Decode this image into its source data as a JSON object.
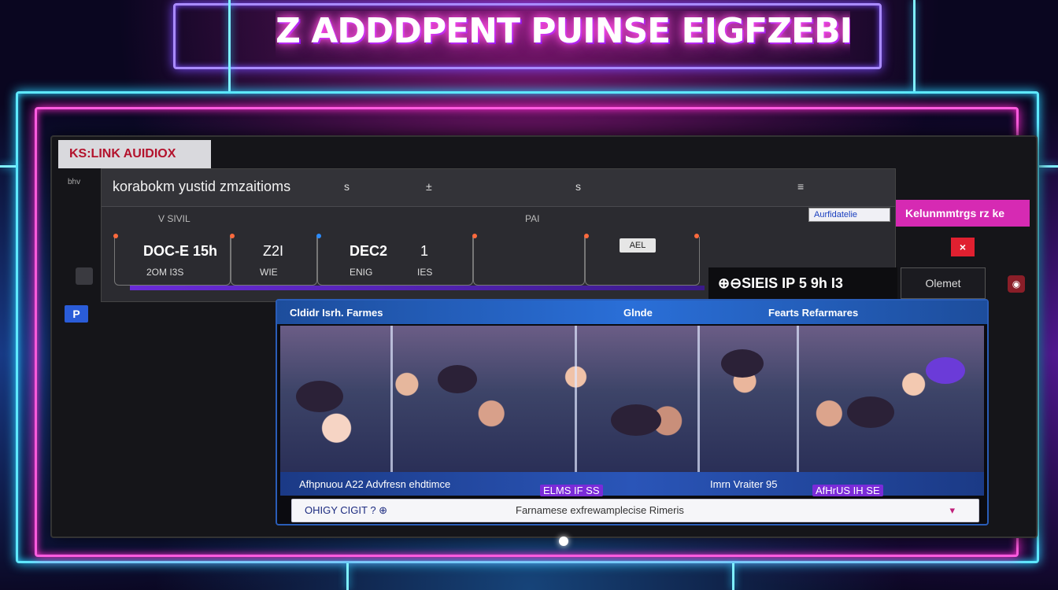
{
  "banner": {
    "title": "Z ADDDPENT PUINSE EIGFZEBIOM"
  },
  "app": {
    "tag": "KS:LINK AUIDIOX",
    "side_tab": "bhv",
    "side_badge": "P"
  },
  "panel": {
    "title": "korabokm yustid zmzaitioms",
    "header_icons": [
      "s",
      "±",
      "s",
      "≡"
    ],
    "sub_left": "V SIVIL",
    "sub_mid": "PAI",
    "stats": [
      {
        "value": "DOC-E 15h",
        "sub": "2OM I3S"
      },
      {
        "value": "Z2I",
        "sub": "WIE"
      },
      {
        "value": "DEC2",
        "sub": "ENIG"
      },
      {
        "value": "1",
        "sub": "IES"
      },
      {
        "value": "",
        "sub": ""
      }
    ],
    "mini_badge": "AEL"
  },
  "side": {
    "search_label": "Aurfidatelie",
    "pink_banner": "Kelunmmtrgs rz ke",
    "action_strip": "⊕⊖SIEIS IP 5 9h I3",
    "ghost_button": "Olemet"
  },
  "media": {
    "head_left": "Cldidr Isrh. Farmes",
    "head_mid": "Glnde",
    "head_right": "Fearts Refarmares",
    "captions": [
      "Afhpnuou A22 Advfresn ehdtimce",
      "ELMS IF SS",
      "Imrn Vraiter 95",
      "AfHrUS IH SE"
    ],
    "input_left": "OHIGY CIGIT  ?  ⊕",
    "input_right": "Farnamese exfrewamplecise Rimeris"
  }
}
